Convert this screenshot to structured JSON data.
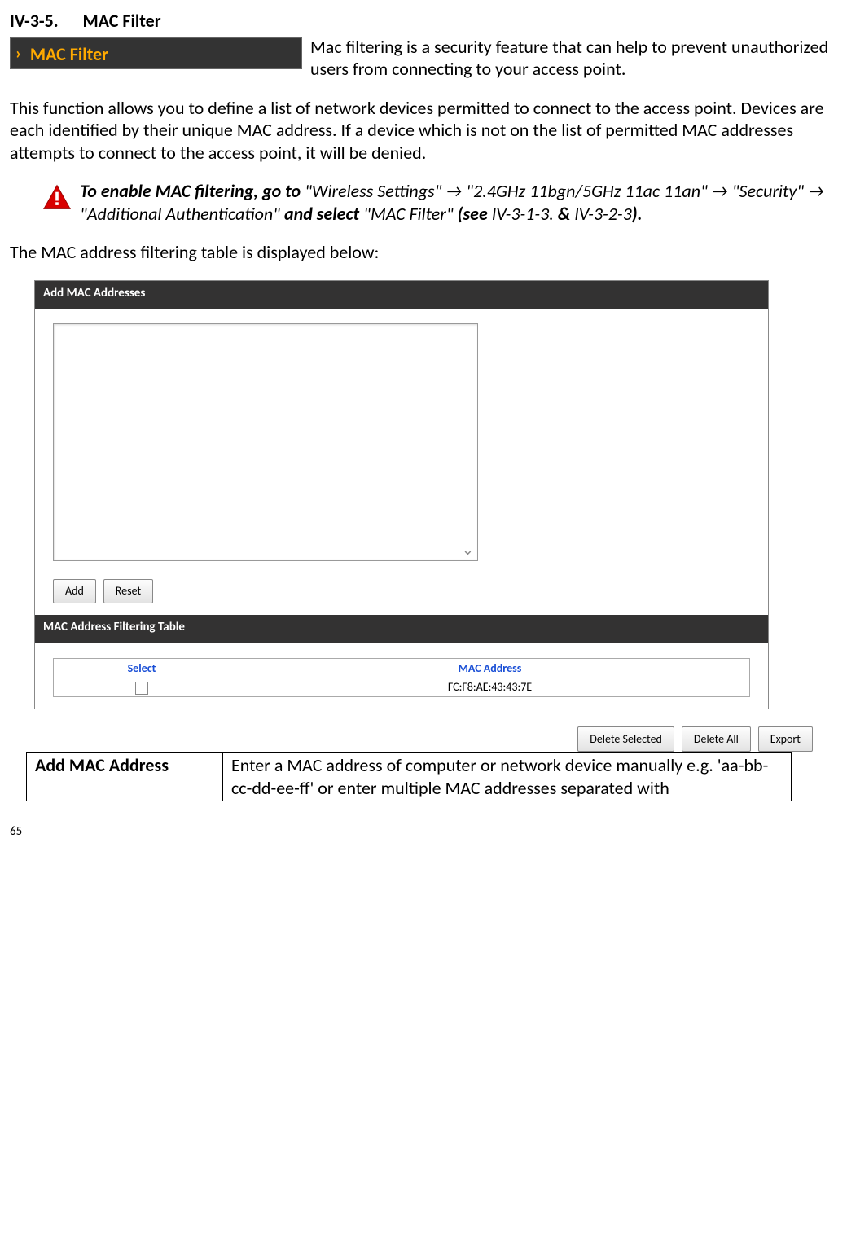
{
  "section": {
    "number": "IV-3-5.",
    "title": "MAC Filter"
  },
  "nav_tag": "MAC Filter",
  "intro": {
    "p1a": "Mac filtering is a security feature that can help to prevent unauthorized users from connecting to your access point.",
    "p2": "This function allows you to define a list of network devices permitted to connect to the access point. Devices are each identified by their unique MAC address. If a device which is not on the list of permitted MAC addresses attempts to connect to the access point, it will be denied."
  },
  "alert": {
    "t1": "To enable MAC filtering, go to ",
    "t2": "\"Wireless Settings\" → \"2.4GHz 11bgn/5GHz 11ac 11an\" → \"Security\" → \"Additional Authentication\" ",
    "t3": "and select ",
    "t4": "\"MAC Filter\" ",
    "t5": "(see ",
    "t6": "IV-3-1-3. ",
    "t7": "& ",
    "t8": "IV-3-2-3",
    "t9": ")."
  },
  "table_caption": "The MAC address filtering table is displayed below:",
  "panel1": {
    "title": "Add MAC Addresses",
    "add_btn": "Add",
    "reset_btn": "Reset"
  },
  "panel2": {
    "title": "MAC Address Filtering Table",
    "col_select": "Select",
    "col_mac": "MAC Address",
    "rows": [
      {
        "mac": "FC:F8:AE:43:43:7E"
      }
    ]
  },
  "actions": {
    "delete_selected": "Delete Selected",
    "delete_all": "Delete All",
    "export": "Export"
  },
  "def": {
    "term": "Add MAC Address",
    "desc": "Enter a MAC address of computer or network device manually e.g. 'aa-bb-cc-dd-ee-ff' or enter multiple MAC addresses separated with"
  },
  "page_number": "65"
}
